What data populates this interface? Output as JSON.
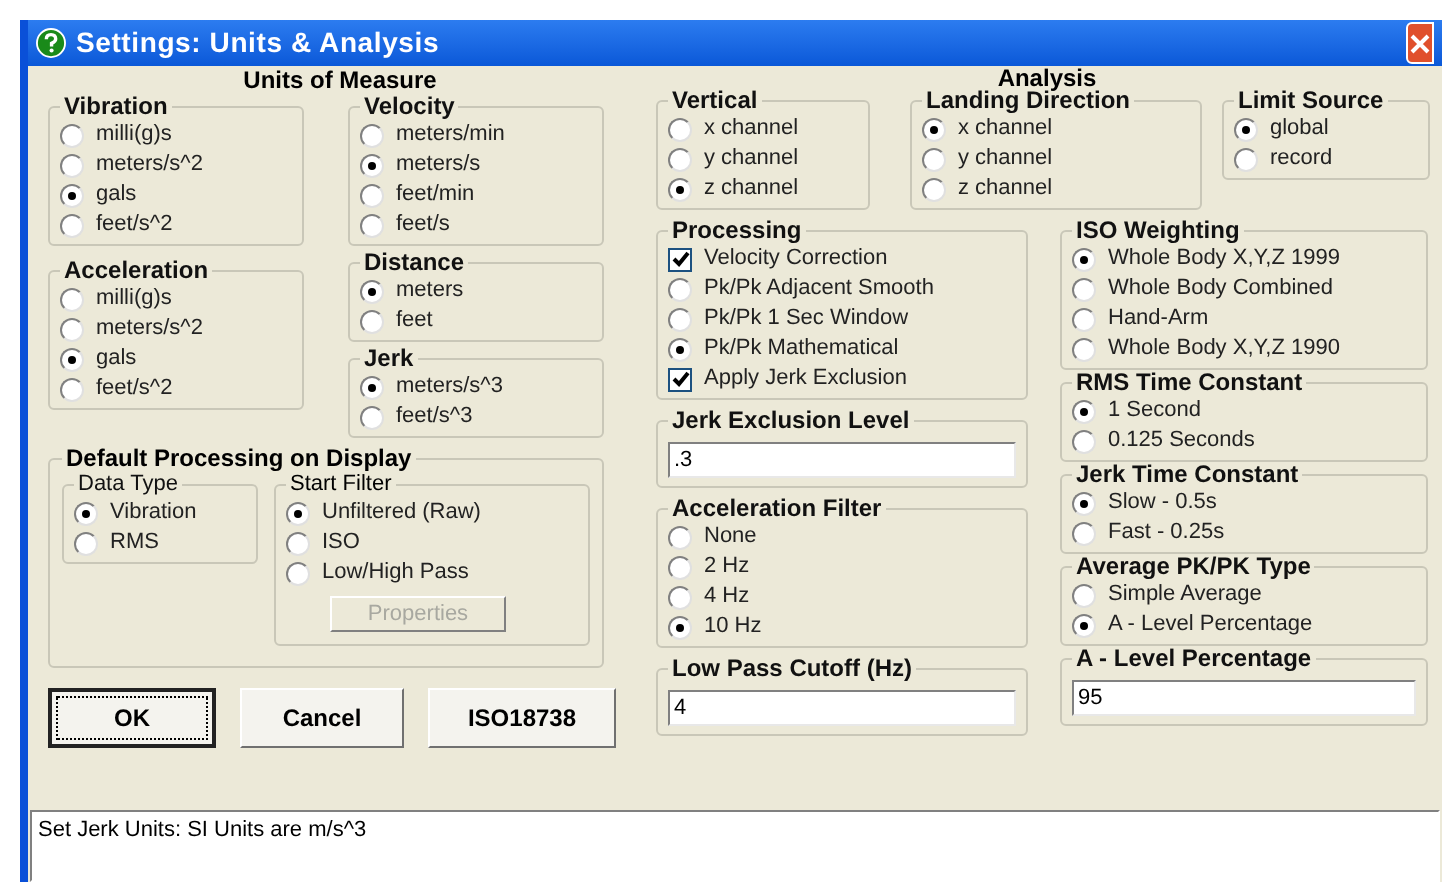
{
  "window": {
    "title": "Settings: Units & Analysis"
  },
  "units": {
    "heading": "Units of Measure",
    "left_groups": [
      {
        "kind": "choices",
        "title": "Vibration",
        "options": [
          {
            "label": "milli(g)s",
            "selected": false
          },
          {
            "label": "meters/s^2",
            "selected": false
          },
          {
            "label": "gals",
            "selected": true
          },
          {
            "label": "feet/s^2",
            "selected": false
          }
        ]
      },
      {
        "kind": "choices",
        "title": "Acceleration",
        "options": [
          {
            "label": "milli(g)s",
            "selected": false
          },
          {
            "label": "meters/s^2",
            "selected": false
          },
          {
            "label": "gals",
            "selected": true
          },
          {
            "label": "feet/s^2",
            "selected": false
          }
        ]
      }
    ],
    "right_groups": [
      {
        "kind": "choices",
        "title": "Velocity",
        "options": [
          {
            "label": "meters/min",
            "selected": false
          },
          {
            "label": "meters/s",
            "selected": true
          },
          {
            "label": "feet/min",
            "selected": false
          },
          {
            "label": "feet/s",
            "selected": false
          }
        ]
      },
      {
        "kind": "choices",
        "title": "Distance",
        "options": [
          {
            "label": "meters",
            "selected": true
          },
          {
            "label": "feet",
            "selected": false
          }
        ]
      },
      {
        "kind": "choices",
        "title": "Jerk",
        "options": [
          {
            "label": "meters/s^3",
            "selected": true
          },
          {
            "label": "feet/s^3",
            "selected": false
          }
        ]
      }
    ]
  },
  "default_processing": {
    "title": "Default Processing on Display",
    "data_type": {
      "title": "Data Type",
      "options": [
        {
          "label": "Vibration",
          "selected": true
        },
        {
          "label": "RMS",
          "selected": false
        }
      ]
    },
    "start_filter": {
      "title": "Start Filter",
      "options": [
        {
          "label": "Unfiltered (Raw)",
          "selected": true
        },
        {
          "label": "ISO",
          "selected": false
        },
        {
          "label": "Low/High Pass",
          "selected": false
        }
      ],
      "button": {
        "label": "Properties",
        "disabled": true
      }
    }
  },
  "buttons": [
    {
      "label": "OK",
      "focused": true
    },
    {
      "label": "Cancel",
      "focused": false
    },
    {
      "label": "ISO18738",
      "focused": false
    }
  ],
  "analysis": {
    "heading": "Analysis",
    "top_groups": [
      {
        "kind": "choices",
        "title": "Vertical",
        "options": [
          {
            "label": "x channel",
            "selected": false
          },
          {
            "label": "y channel",
            "selected": false
          },
          {
            "label": "z channel",
            "selected": true
          }
        ]
      },
      {
        "kind": "choices",
        "title": "Landing Direction",
        "options": [
          {
            "label": "x channel",
            "selected": true
          },
          {
            "label": "y channel",
            "selected": false
          },
          {
            "label": "z channel",
            "selected": false
          }
        ]
      },
      {
        "kind": "choices",
        "title": "Limit Source",
        "options": [
          {
            "label": "global",
            "selected": true
          },
          {
            "label": "record",
            "selected": false
          }
        ]
      }
    ],
    "left_groups": [
      {
        "kind": "choices",
        "title": "Processing",
        "options": [
          {
            "kind": "checkbox",
            "label": "Velocity Correction",
            "checked": true
          },
          {
            "kind": "radio",
            "label": "Pk/Pk Adjacent Smooth",
            "selected": false
          },
          {
            "kind": "radio",
            "label": "Pk/Pk 1 Sec Window",
            "selected": false
          },
          {
            "kind": "radio",
            "label": "Pk/Pk Mathematical",
            "selected": true
          },
          {
            "kind": "checkbox",
            "label": "Apply Jerk Exclusion",
            "checked": true
          }
        ]
      },
      {
        "kind": "field",
        "title": "Jerk Exclusion Level",
        "value": ".3"
      },
      {
        "kind": "choices",
        "title": "Acceleration Filter",
        "options": [
          {
            "label": "None",
            "selected": false
          },
          {
            "label": "2 Hz",
            "selected": false
          },
          {
            "label": "4 Hz",
            "selected": false
          },
          {
            "label": "10 Hz",
            "selected": true
          }
        ]
      },
      {
        "kind": "field",
        "title": "Low Pass Cutoff (Hz)",
        "value": "4"
      }
    ],
    "right_groups": [
      {
        "kind": "choices",
        "title": "ISO Weighting",
        "options": [
          {
            "label": "Whole Body X,Y,Z 1999",
            "selected": true
          },
          {
            "label": "Whole Body Combined",
            "selected": false
          },
          {
            "label": "Hand-Arm",
            "selected": false
          },
          {
            "label": "Whole Body X,Y,Z 1990",
            "selected": false
          }
        ]
      },
      {
        "kind": "choices",
        "title": "RMS Time Constant",
        "options": [
          {
            "label": "1 Second",
            "selected": true
          },
          {
            "label": "0.125 Seconds",
            "selected": false
          }
        ]
      },
      {
        "kind": "choices",
        "title": "Jerk Time Constant",
        "options": [
          {
            "label": "Slow - 0.5s",
            "selected": true
          },
          {
            "label": "Fast - 0.25s",
            "selected": false
          }
        ]
      },
      {
        "kind": "choices",
        "title": "Average PK/PK Type",
        "options": [
          {
            "label": "Simple Average",
            "selected": false
          },
          {
            "label": "A - Level Percentage",
            "selected": true
          }
        ]
      },
      {
        "kind": "field",
        "title": "A - Level Percentage",
        "value": "95"
      }
    ]
  },
  "status": {
    "text": "Set Jerk Units: SI Units are m/s^3"
  }
}
